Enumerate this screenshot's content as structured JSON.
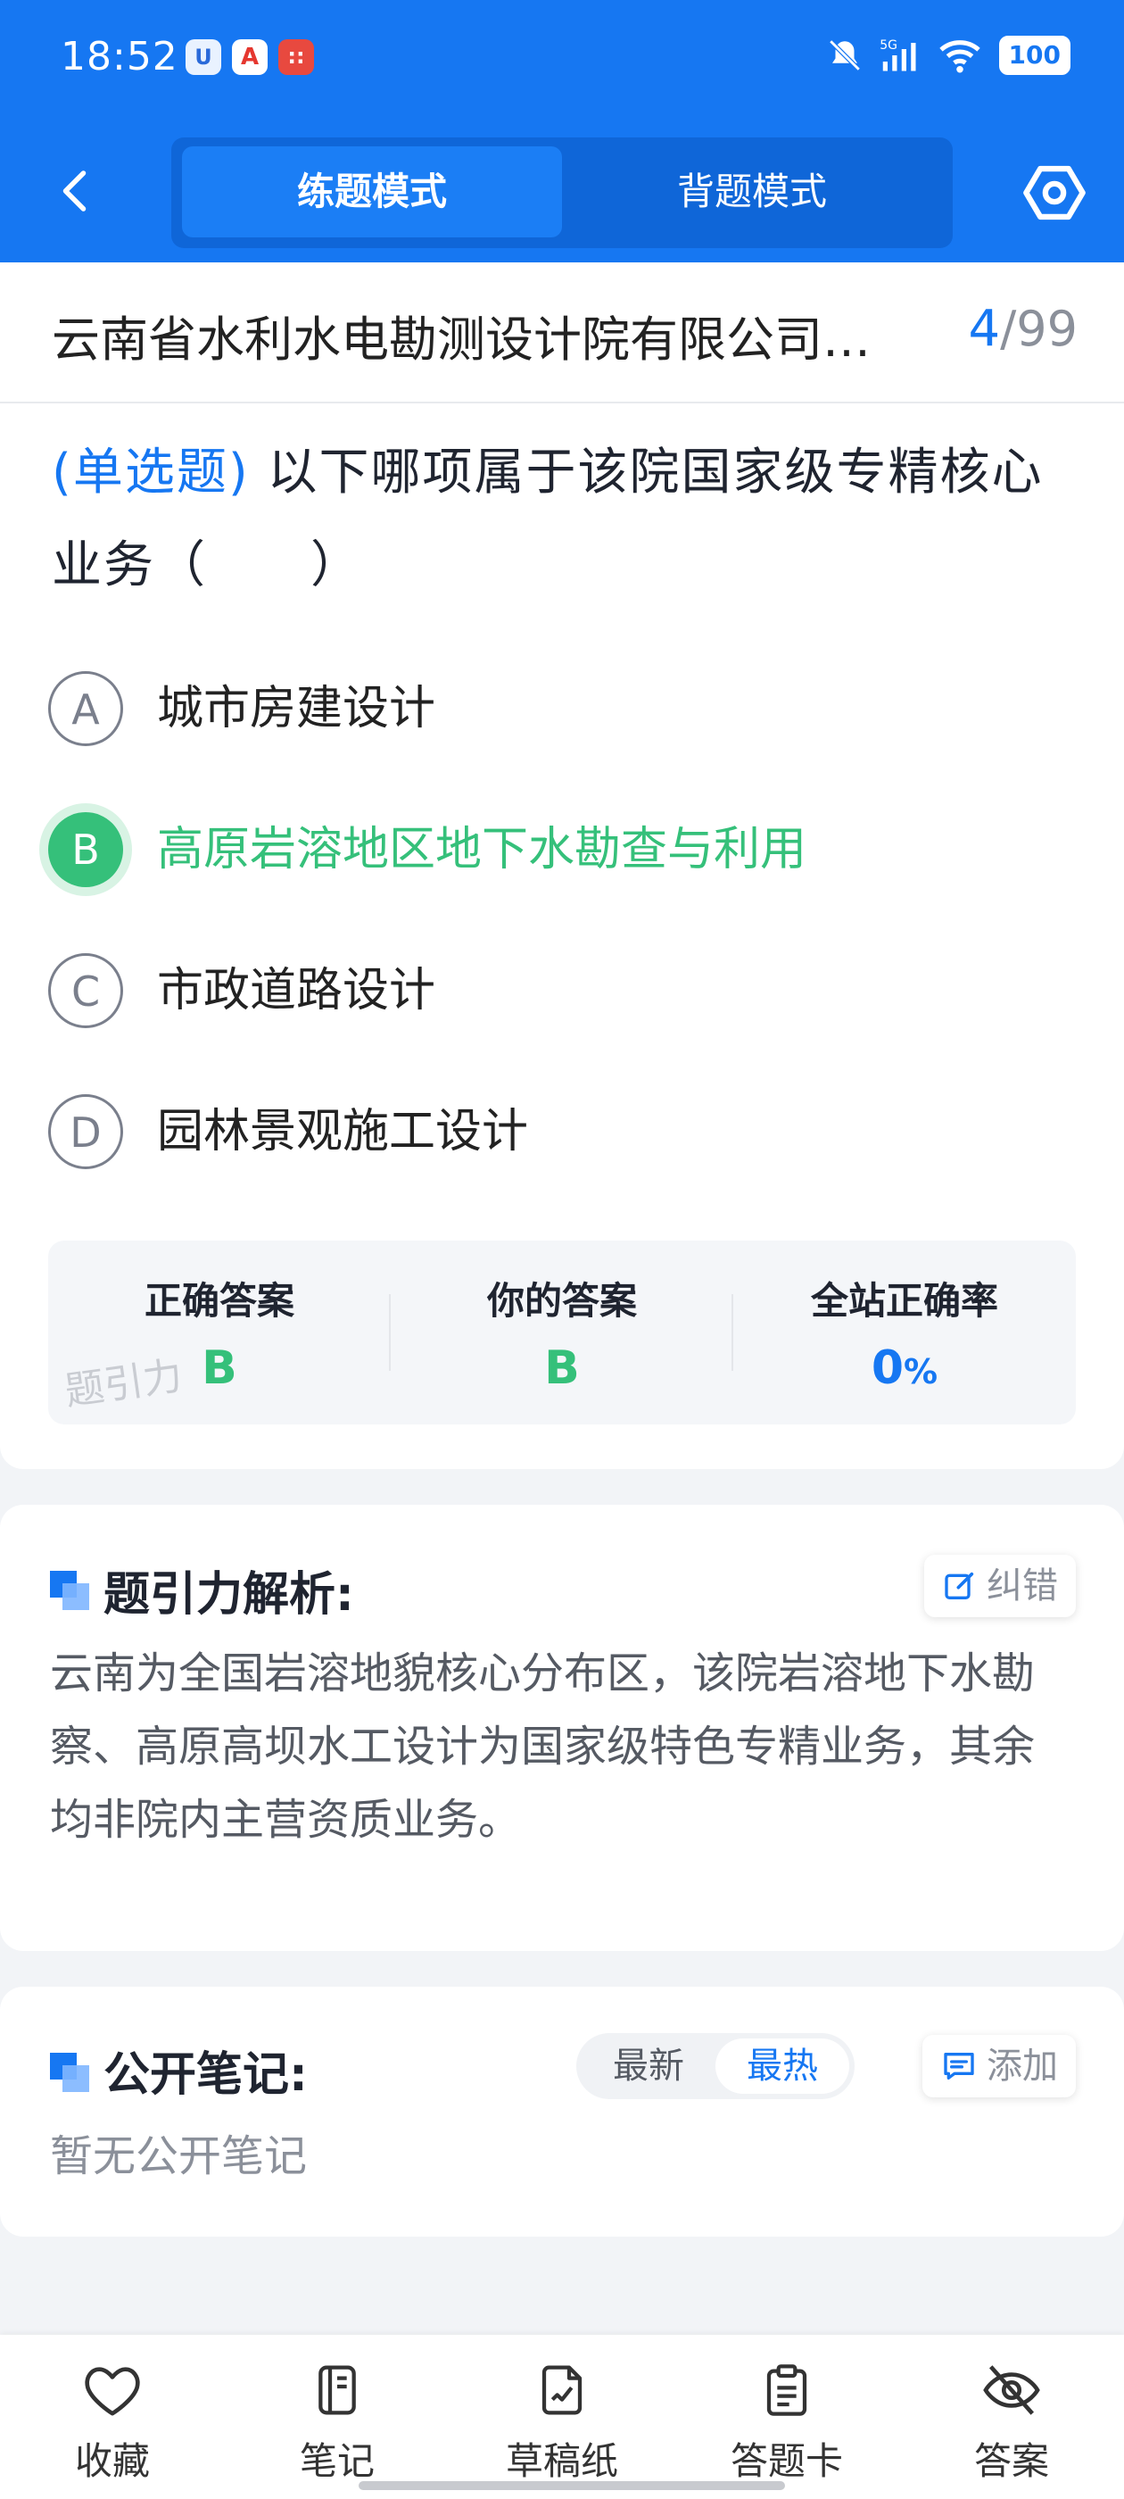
{
  "status_bar": {
    "time": "18:52",
    "battery": "100",
    "network": "5G"
  },
  "nav": {
    "tabs": [
      {
        "label": "练题模式",
        "active": true
      },
      {
        "label": "背题模式",
        "active": false
      }
    ]
  },
  "question": {
    "title": "云南省水利水电勘测设计院有限公司…",
    "current": "4",
    "separator": "/",
    "total": "99",
    "type_label": "(单选题)",
    "text": "以下哪项属于该院国家级专精核心业务（　　）",
    "options": [
      {
        "letter": "A",
        "text": "城市房建设计"
      },
      {
        "letter": "B",
        "text": "高原岩溶地区地下水勘查与利用",
        "selected": true
      },
      {
        "letter": "C",
        "text": "市政道路设计"
      },
      {
        "letter": "D",
        "text": "园林景观施工设计"
      }
    ]
  },
  "answers": {
    "correct_label": "正确答案",
    "correct_value": "B",
    "yours_label": "你的答案",
    "yours_value": "B",
    "rate_label": "全站正确率",
    "rate_value": "0",
    "rate_unit": "%",
    "watermark": "题引力"
  },
  "analysis": {
    "title": "题引力解析:",
    "correct_btn": "纠错",
    "text": "云南为全国岩溶地貌核心分布区，该院岩溶地下水勘察、高原高坝水工设计为国家级特色专精业务，其余均非院内主营资质业务。"
  },
  "notes": {
    "title": "公开笔记:",
    "sort_new": "最新",
    "sort_hot": "最热",
    "add_btn": "添加",
    "empty": "暂无公开笔记"
  },
  "bottom_bar": {
    "items": [
      {
        "label": "收藏",
        "icon": "heart-icon"
      },
      {
        "label": "笔记",
        "icon": "notebook-icon"
      },
      {
        "label": "草稿纸",
        "icon": "draft-icon"
      },
      {
        "label": "答题卡",
        "icon": "clipboard-icon"
      },
      {
        "label": "答案",
        "icon": "eye-off-icon"
      }
    ]
  },
  "colors": {
    "primary": "#1677f2",
    "success": "#35c07a"
  }
}
